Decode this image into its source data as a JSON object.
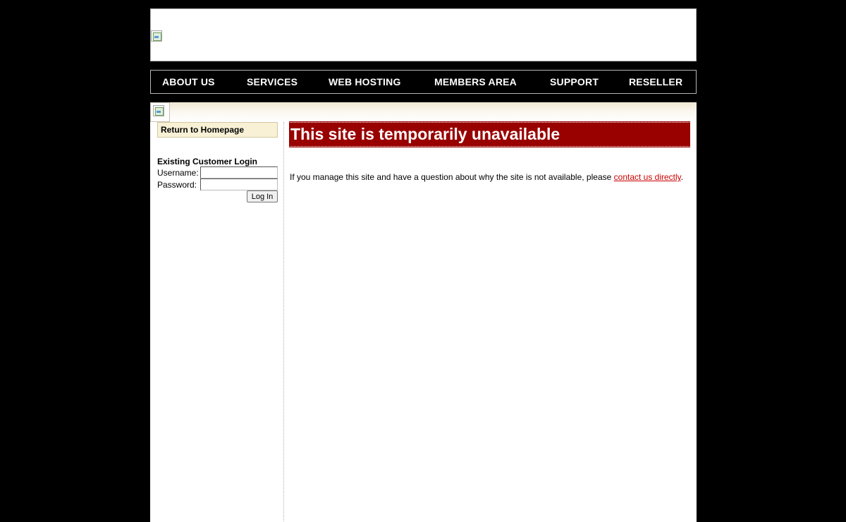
{
  "nav": {
    "items": [
      {
        "label": "ABOUT US"
      },
      {
        "label": "SERVICES"
      },
      {
        "label": "WEB HOSTING"
      },
      {
        "label": "MEMBERS AREA"
      },
      {
        "label": "SUPPORT"
      },
      {
        "label": "RESELLER"
      }
    ]
  },
  "sidebar": {
    "return_label": "Return to Homepage",
    "login": {
      "title": "Existing Customer Login",
      "username_label": "Username:",
      "password_label": "Password:",
      "username_value": "",
      "password_value": "",
      "button_label": "Log In"
    }
  },
  "main": {
    "title": "This site is temporarily unavailable",
    "message_prefix": "If you manage this site and have a question about why the site is not available, please ",
    "contact_link": "contact us directly",
    "message_suffix": "."
  },
  "colors": {
    "page_bg": "#000000",
    "title_bar": "#990000",
    "link": "#cc0000",
    "return_box_bg": "#f8f1d6"
  }
}
